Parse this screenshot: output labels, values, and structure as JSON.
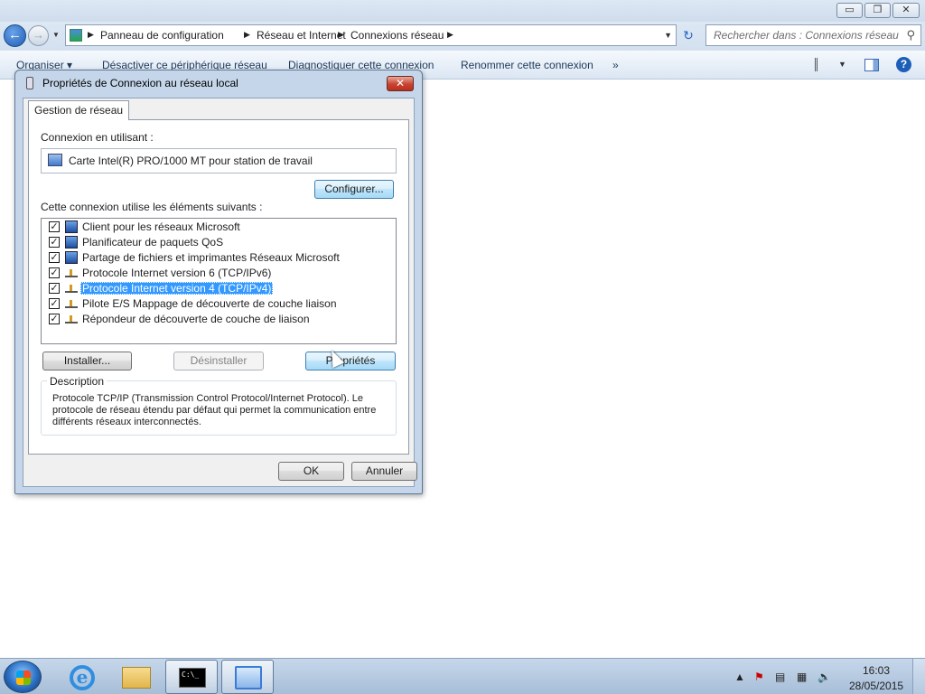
{
  "explorer": {
    "caption_buttons": {
      "minimize": "▭",
      "maximize": "❐",
      "close": "✕"
    },
    "breadcrumbs": [
      "Panneau de configuration",
      "Réseau et Internet",
      "Connexions réseau"
    ],
    "search_placeholder": "Rechercher dans : Connexions réseau",
    "commands": [
      "Organiser ▾",
      "Désactiver ce périphérique réseau",
      "Diagnostiquer cette connexion",
      "Renommer cette connexion",
      "»"
    ],
    "help_label": "?"
  },
  "dialog": {
    "title": "Propriétés de Connexion au réseau local",
    "close_label": "✕",
    "tab_label": "Gestion de réseau",
    "connect_using_label": "Connexion en utilisant :",
    "adapter_name": "Carte Intel(R) PRO/1000 MT pour station de travail",
    "configure_button": "Configurer...",
    "items_label": "Cette connexion utilise les éléments suivants :",
    "items": [
      {
        "label": "Client pour les réseaux Microsoft",
        "checked": true,
        "icon": "network-client-icon",
        "selected": false
      },
      {
        "label": "Planificateur de paquets QoS",
        "checked": true,
        "icon": "network-service-icon",
        "selected": false
      },
      {
        "label": "Partage de fichiers et imprimantes Réseaux Microsoft",
        "checked": true,
        "icon": "network-service-icon",
        "selected": false
      },
      {
        "label": "Protocole Internet version 6 (TCP/IPv6)",
        "checked": true,
        "icon": "protocol-icon",
        "selected": false
      },
      {
        "label": "Protocole Internet version 4 (TCP/IPv4)",
        "checked": true,
        "icon": "protocol-icon",
        "selected": true
      },
      {
        "label": "Pilote E/S Mappage de découverte de couche liaison",
        "checked": true,
        "icon": "protocol-icon",
        "selected": false
      },
      {
        "label": "Répondeur de découverte de couche de liaison",
        "checked": true,
        "icon": "protocol-icon",
        "selected": false
      }
    ],
    "install_button": "Installer...",
    "uninstall_button": "Désinstaller",
    "properties_button": "Propriétés",
    "description_title": "Description",
    "description_text": "Protocole TCP/IP (Transmission Control Protocol/Internet Protocol). Le protocole de réseau étendu par défaut qui permet la communication entre différents réseaux interconnectés.",
    "ok_button": "OK",
    "cancel_button": "Annuler"
  },
  "taskbar": {
    "cmd_icon_text": "C:\\_",
    "clock_time": "16:03",
    "clock_date": "28/05/2015"
  },
  "colors": {
    "selection": "#3399ff",
    "title_bar": "#cfdcec",
    "close_button": "#c94331"
  }
}
